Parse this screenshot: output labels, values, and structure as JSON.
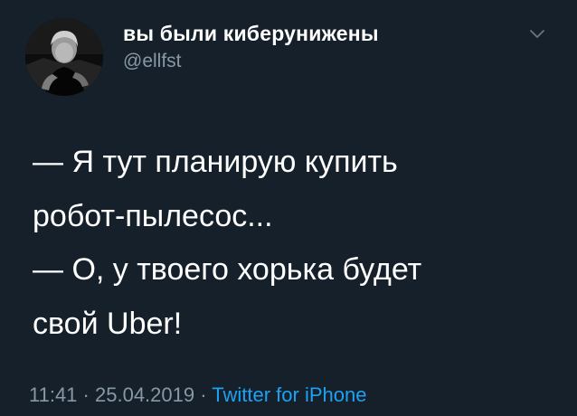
{
  "author": {
    "display_name": "вы были киберунижены",
    "handle": "@ellfst"
  },
  "tweet": {
    "lines": [
      "— Я тут планирую купить",
      "робот-пылесос...",
      "— О, у твоего хорька будет",
      "свой Uber!"
    ]
  },
  "meta": {
    "time": "11:41",
    "separator": "·",
    "date": "25.04.2019",
    "source": "Twitter for iPhone"
  },
  "icons": {
    "menu": "chevron-down-icon",
    "avatar": "avatar"
  },
  "colors": {
    "background": "#15202b",
    "text": "#ffffff",
    "secondary": "#8899a6",
    "link": "#1da1f2"
  }
}
